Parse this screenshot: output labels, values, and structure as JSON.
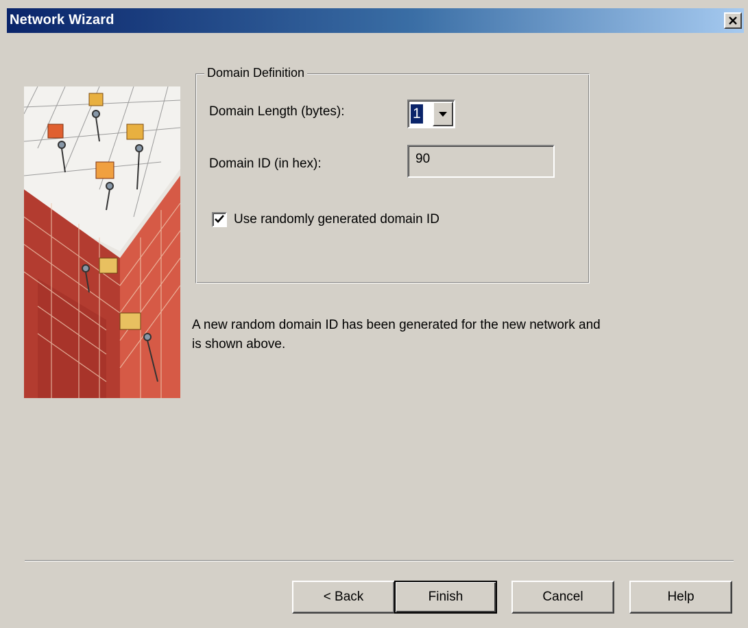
{
  "window": {
    "title": "Network Wizard",
    "close_glyph": "✕"
  },
  "illustration": {
    "icon": "people-carrying-boxes-on-brick-building-illustration"
  },
  "domain_definition": {
    "legend": "Domain Definition",
    "length_label": "Domain Length (bytes):",
    "length_value": "1",
    "id_label": "Domain ID (in hex):",
    "id_value": "90",
    "random_checkbox_label": "Use randomly generated domain ID",
    "random_checked": true
  },
  "info_text": "A new random domain ID has been generated for the new network and is shown above.",
  "buttons": {
    "back": "< Back",
    "finish": "Finish",
    "cancel": "Cancel",
    "help": "Help"
  },
  "colors": {
    "titlebar_start": "#0a246a",
    "titlebar_end": "#a6caf0",
    "dialog_bg": "#d4d0c8",
    "selection": "#0a246a"
  }
}
